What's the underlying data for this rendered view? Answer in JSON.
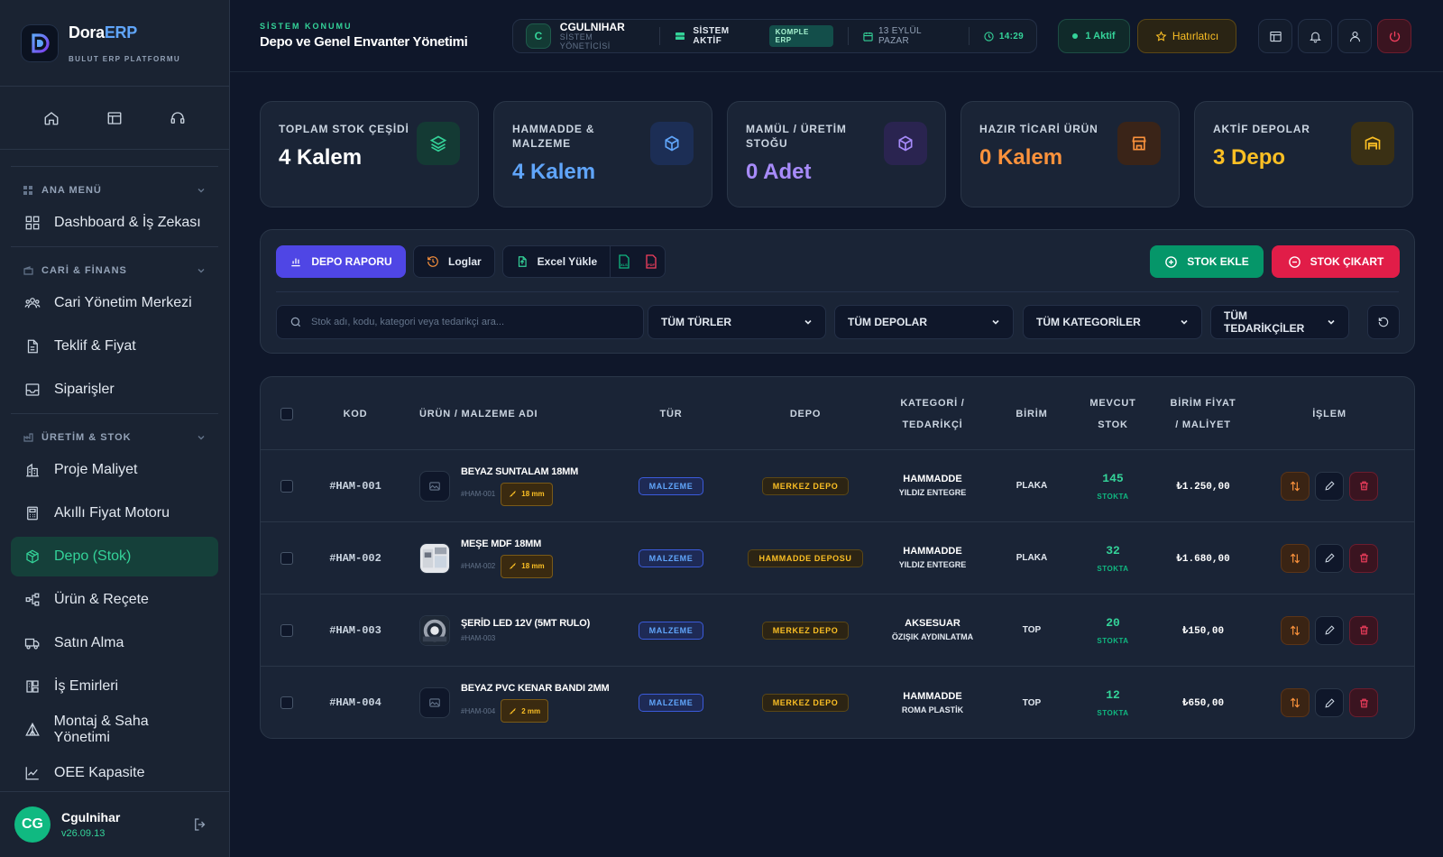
{
  "brand": {
    "name_a": "Dora",
    "name_b": "ERP",
    "subtitle": "BULUT ERP PLATFORMU"
  },
  "quick_icons": [
    "home-icon",
    "layout-icon",
    "headset-icon"
  ],
  "sections": [
    {
      "title": "ANA MENÜ",
      "items": [
        {
          "label": "Dashboard & İş Zekası",
          "icon": "grid-icon"
        }
      ]
    },
    {
      "title": "CARİ & FİNANS",
      "items": [
        {
          "label": "Cari Yönetim Merkezi",
          "icon": "users-icon"
        },
        {
          "label": "Teklif & Fiyat",
          "icon": "document-icon"
        },
        {
          "label": "Siparişler",
          "icon": "inbox-icon"
        }
      ]
    },
    {
      "title": "ÜRETİM & STOK",
      "items": [
        {
          "label": "Proje Maliyet",
          "icon": "building-icon"
        },
        {
          "label": "Akıllı Fiyat Motoru",
          "icon": "calculator-icon"
        },
        {
          "label": "Depo (Stok)",
          "icon": "box-icon",
          "active": true
        },
        {
          "label": "Ürün & Reçete",
          "icon": "tree-icon"
        },
        {
          "label": "Satın Alma",
          "icon": "truck-icon"
        },
        {
          "label": "İş Emirleri",
          "icon": "workorder-icon"
        },
        {
          "label": "Montaj & Saha Yönetimi",
          "icon": "tent-icon"
        },
        {
          "label": "OEE Kapasite",
          "icon": "chart-line-icon"
        }
      ]
    }
  ],
  "user": {
    "initials": "CG",
    "name": "Cgulnihar",
    "version": "v26.09.13"
  },
  "topbar": {
    "location_label": "SİSTEM KONUMU",
    "location_title": "Depo ve Genel Envanter Yönetimi",
    "status_initial": "C",
    "status_user": "CGULNIHAR",
    "status_role": "SİSTEM YÖNETİCİSİ",
    "system_status": "SİSTEM AKTİF",
    "erp_badge": "KOMPLE ERP",
    "date": "13 EYLÜL PAZAR",
    "time": "14:29",
    "active_label": "1 Aktif",
    "reminder_label": "Hatırlatıcı"
  },
  "stat_cards": [
    {
      "label": "TOPLAM STOK ÇEŞİDİ",
      "value": "4 Kalem",
      "color": "#ffffff",
      "icon": "layers-icon",
      "icon_color": "#34d399",
      "icon_bg": "#143a34"
    },
    {
      "label": "HAMMADDE & MALZEME",
      "value": "4 Kalem",
      "color": "#60a5fa",
      "icon": "cube-icon",
      "icon_color": "#60a5fa",
      "icon_bg": "#1c2e55"
    },
    {
      "label": "MAMÜL / ÜRETİM STOĞU",
      "value": "0 Adet",
      "color": "#a78bfa",
      "icon": "cube-alt-icon",
      "icon_color": "#a78bfa",
      "icon_bg": "#2a2450"
    },
    {
      "label": "HAZIR TİCARİ ÜRÜN",
      "value": "0 Kalem",
      "color": "#fb923c",
      "icon": "store-icon",
      "icon_color": "#fb923c",
      "icon_bg": "#3a2418"
    },
    {
      "label": "AKTİF DEPOLAR",
      "value": "3 Depo",
      "color": "#fbbf24",
      "icon": "warehouse-icon",
      "icon_color": "#fbbf24",
      "icon_bg": "#3a3014"
    }
  ],
  "toolbar": {
    "report": "DEPO RAPORU",
    "logs": "Loglar",
    "excel": "Excel Yükle",
    "xls": "XLS",
    "pdf": "PDF",
    "add": "STOK EKLE",
    "remove": "STOK ÇIKART",
    "search_placeholder": "Stok adı, kodu, kategori veya tedarikçi ara...",
    "filters": [
      "TÜM TÜRLER",
      "TÜM DEPOLAR",
      "TÜM KATEGORİLER",
      "TÜM TEDARİKÇİLER"
    ]
  },
  "table": {
    "headers": {
      "code": "KOD",
      "name": "ÜRÜN / MALZEME ADI",
      "type": "TÜR",
      "depot": "DEPO",
      "cat1": "KATEGORİ /",
      "cat2": "TEDARİKÇİ",
      "unit": "BİRİM",
      "stock1": "MEVCUT",
      "stock2": "STOK",
      "price1": "BİRİM FİYAT",
      "price2": "/ MALİYET",
      "action": "İŞLEM"
    },
    "rows": [
      {
        "code": "#HAM-001",
        "name": "BEYAZ SUNTALAM 18MM",
        "sub": "#HAM-001",
        "thickness": "18 mm",
        "thumb": "image-icon",
        "type": "MALZEME",
        "depot": "MERKEZ DEPO",
        "category": "HAMMADDE",
        "supplier": "YILDIZ ENTEGRE",
        "unit": "PLAKA",
        "stock": "145",
        "stock_label": "STOKTA",
        "price": "₺1.250,00"
      },
      {
        "code": "#HAM-002",
        "name": "MEŞE MDF 18MM",
        "sub": "#HAM-002",
        "thickness": "18 mm",
        "thumb": "kitchen-photo",
        "type": "MALZEME",
        "depot": "HAMMADDE DEPOSU",
        "category": "HAMMADDE",
        "supplier": "YILDIZ ENTEGRE",
        "unit": "PLAKA",
        "stock": "32",
        "stock_label": "STOKTA",
        "price": "₺1.680,00"
      },
      {
        "code": "#HAM-003",
        "name": "ŞERİD LED 12V (5MT RULO)",
        "sub": "#HAM-003",
        "thickness": "",
        "thumb": "led-photo",
        "type": "MALZEME",
        "depot": "MERKEZ DEPO",
        "category": "AKSESUAR",
        "supplier": "ÖZIŞIK AYDINLATMA",
        "unit": "TOP",
        "stock": "20",
        "stock_label": "STOKTA",
        "price": "₺150,00"
      },
      {
        "code": "#HAM-004",
        "name": "BEYAZ PVC KENAR BANDI 2MM",
        "sub": "#HAM-004",
        "thickness": "2 mm",
        "thumb": "image-icon",
        "type": "MALZEME",
        "depot": "MERKEZ DEPO",
        "category": "HAMMADDE",
        "supplier": "ROMA PLASTİK",
        "unit": "TOP",
        "stock": "12",
        "stock_label": "STOKTA",
        "price": "₺650,00"
      }
    ]
  }
}
